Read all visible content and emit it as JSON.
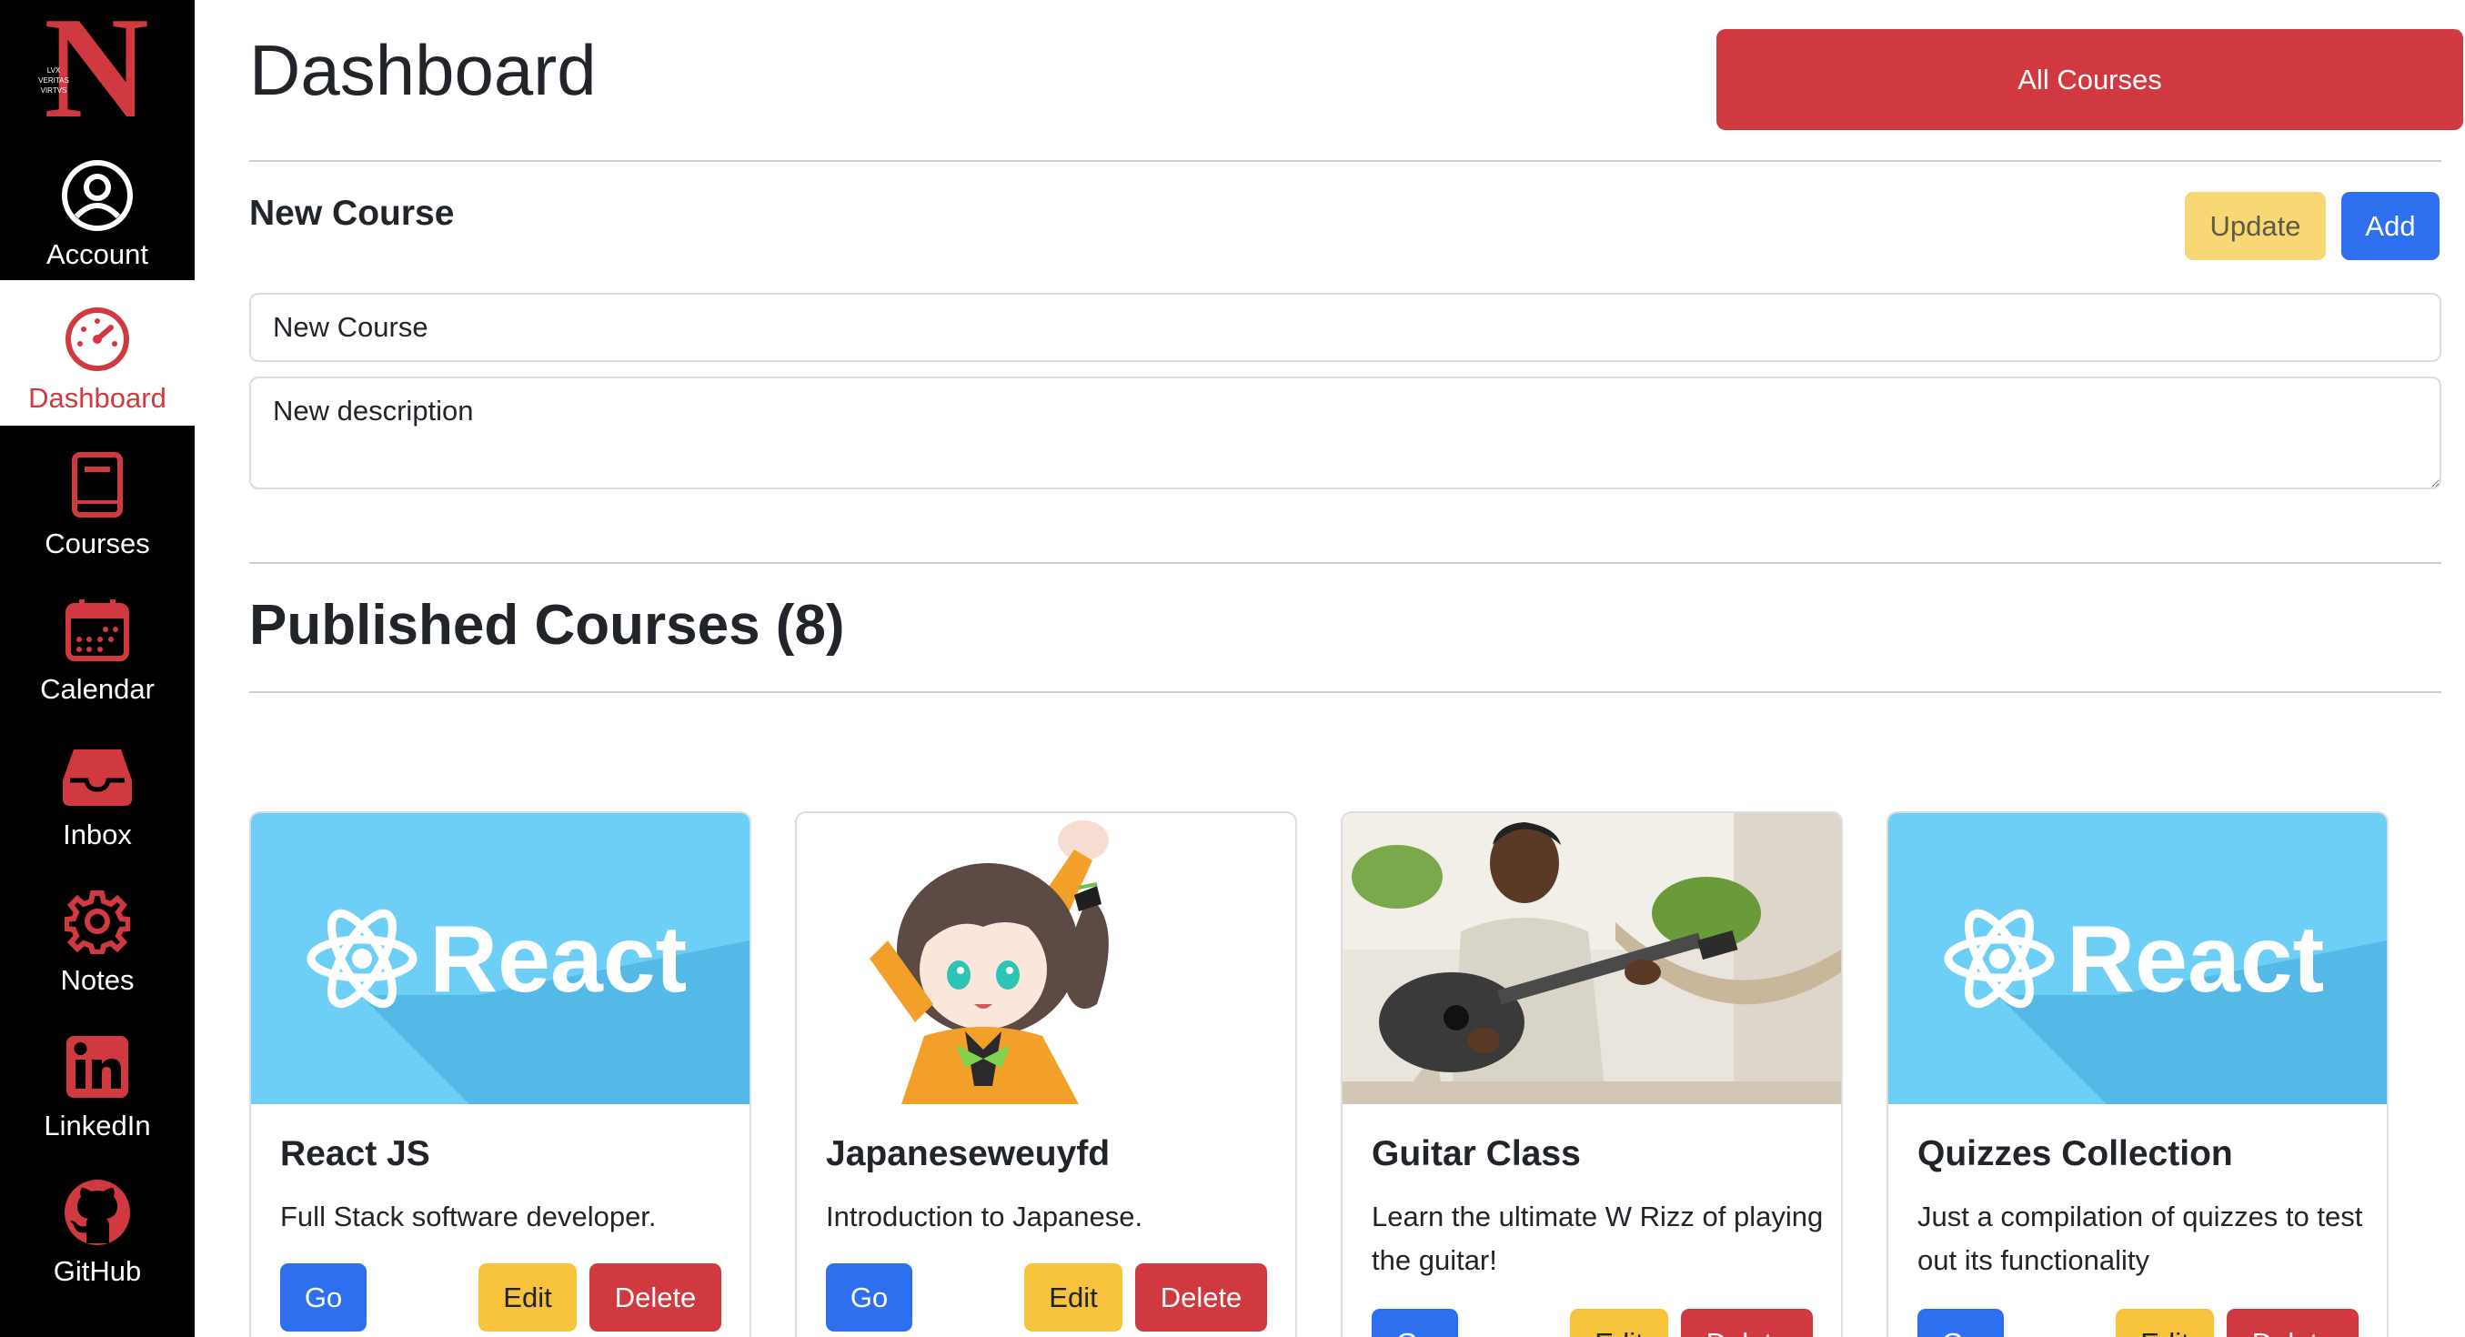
{
  "sidebar": {
    "logo_letter": "N",
    "logo_motto": [
      "LVX",
      "VERITAS",
      "VIRTVS"
    ],
    "items": [
      {
        "label": "Account",
        "icon": "account-icon"
      },
      {
        "label": "Dashboard",
        "icon": "dashboard-icon",
        "active": true
      },
      {
        "label": "Courses",
        "icon": "book-icon"
      },
      {
        "label": "Calendar",
        "icon": "calendar-icon"
      },
      {
        "label": "Inbox",
        "icon": "inbox-icon"
      },
      {
        "label": "Notes",
        "icon": "gear-icon"
      },
      {
        "label": "LinkedIn",
        "icon": "linkedin-icon"
      },
      {
        "label": "GitHub",
        "icon": "github-icon"
      }
    ]
  },
  "header": {
    "title": "Dashboard",
    "all_courses_label": "All Courses"
  },
  "new_course": {
    "heading": "New Course",
    "update_label": "Update",
    "add_label": "Add",
    "name_value": "New Course",
    "description_value": "New description"
  },
  "published": {
    "heading": "Published Courses (8)"
  },
  "courses": [
    {
      "title": "React JS",
      "description": "Full Stack software developer.",
      "image": "react-logo",
      "image_text": "React",
      "go": "Go",
      "edit": "Edit",
      "delete": "Delete"
    },
    {
      "title": "Japaneseweuyfd",
      "description": "Introduction to Japanese.",
      "image": "anime-girl-illustration",
      "go": "Go",
      "edit": "Edit",
      "delete": "Delete"
    },
    {
      "title": "Guitar Class",
      "description": "Learn the ultimate W Rizz of playing the guitar!",
      "image": "man-playing-guitar-photo",
      "go": "Go",
      "edit": "Edit",
      "delete": "Delete"
    },
    {
      "title": "Quizzes Collection",
      "description": "Just a compilation of quizzes to test out its functionality",
      "image": "react-logo",
      "image_text": "React",
      "go": "Go",
      "edit": "Edit",
      "delete": "Delete"
    }
  ],
  "colors": {
    "brand_red": "#d0393f",
    "primary_blue": "#2e6ff0",
    "warning_yellow": "#f7c23c",
    "update_yellow": "#f8d775",
    "sidebar_black": "#000000",
    "react_bg": "#6dcff6"
  }
}
